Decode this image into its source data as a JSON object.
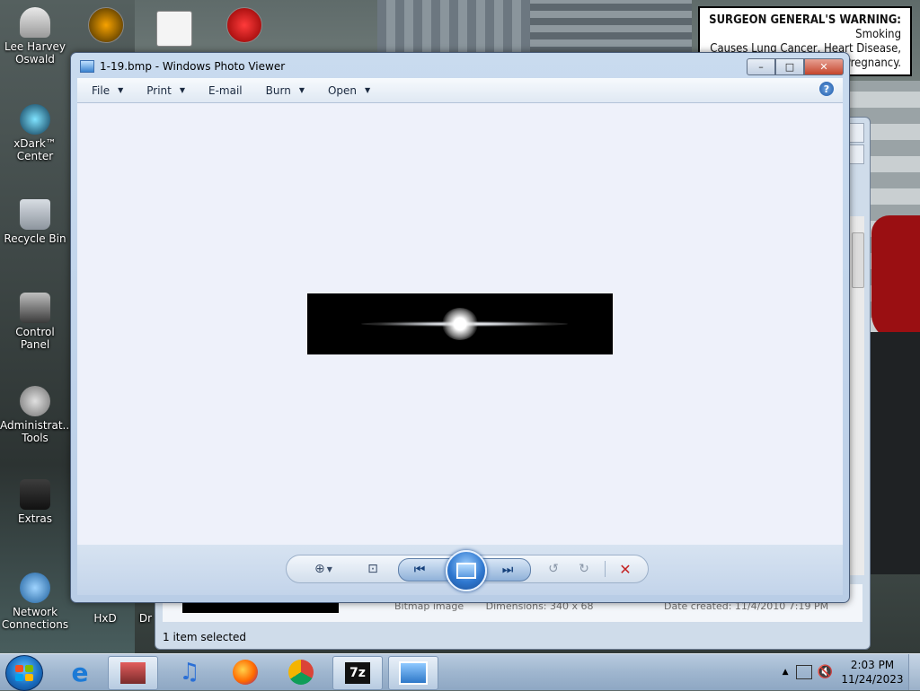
{
  "desktop": {
    "warning_bold": "SURGEON GENERAL'S WARNING:",
    "warning_rest": "Smoking Causes Lung Cancer, Heart Disease, Emphysema, And May Complicate Pregnancy.",
    "warning_visible_line1": "Smoking",
    "warning_visible_line2": "Causes Lung Cancer, Heart Disease,",
    "warning_visible_line3": "Pregnancy.",
    "icons": [
      {
        "label": "Lee Harvey Oswald"
      },
      {
        "label": "xDark™ Center"
      },
      {
        "label": "Recycle Bin"
      },
      {
        "label": "Control Panel"
      },
      {
        "label": "Administrat... Tools"
      },
      {
        "label": "Extras"
      },
      {
        "label": "Network Connections"
      },
      {
        "label": "HxD"
      },
      {
        "label": "Dr"
      }
    ]
  },
  "explorer": {
    "details_type": "Bitmap image",
    "details_dims": "Dimensions: 340 x 68",
    "details_date": "Date created: 11/4/2010 7:19 PM",
    "status": "1 item selected"
  },
  "viewer": {
    "title": "1-19.bmp - Windows Photo Viewer",
    "menu": [
      {
        "label": "File",
        "caret": true
      },
      {
        "label": "Print",
        "caret": true
      },
      {
        "label": "E-mail",
        "caret": false
      },
      {
        "label": "Burn",
        "caret": true
      },
      {
        "label": "Open",
        "caret": true
      }
    ],
    "help": "?",
    "window_buttons": {
      "min": "–",
      "max": "□",
      "close": "✕"
    }
  },
  "taskbar": {
    "time": "2:03 PM",
    "date": "11/24/2023",
    "apps": [
      "internet-explorer",
      "archive-manager",
      "itunes",
      "firefox",
      "chrome",
      "7zip",
      "photo-viewer"
    ]
  },
  "colors": {
    "accent": "#2f78d0",
    "close": "#c4452c"
  }
}
